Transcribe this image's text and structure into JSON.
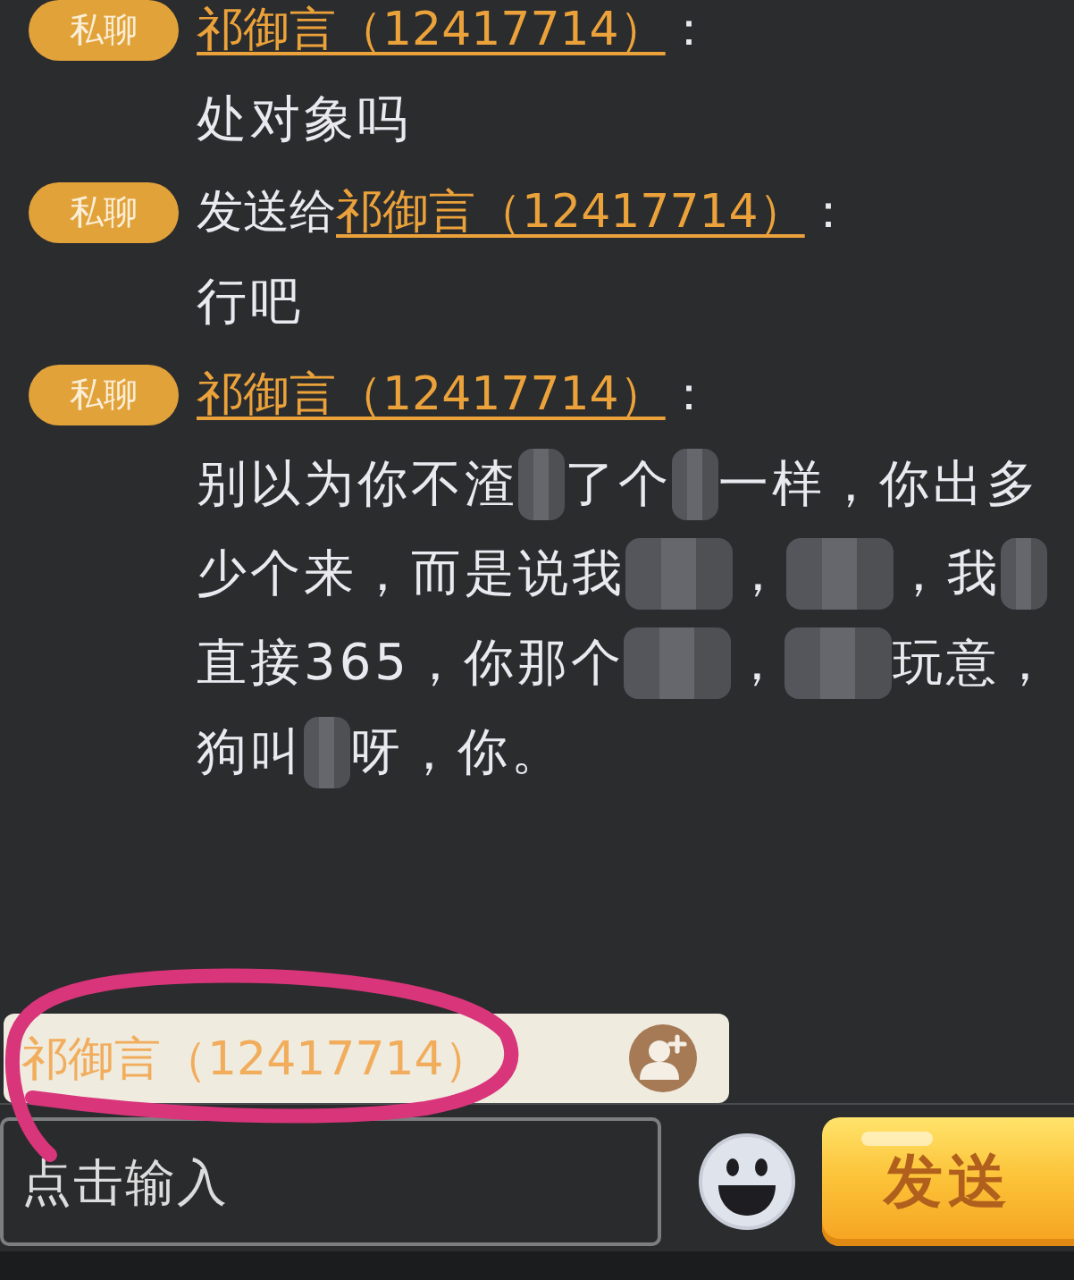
{
  "messages": [
    {
      "badge": "私聊",
      "name": "祁御言（12417714）",
      "separator": "：",
      "lines": [
        [
          {
            "kind": "text",
            "text": "处对象吗"
          }
        ]
      ]
    },
    {
      "badge": "私聊",
      "prefix": "发送给",
      "name": "祁御言（12417714）",
      "separator": "：",
      "lines": [
        [
          {
            "kind": "text",
            "text": "行吧"
          }
        ]
      ]
    },
    {
      "badge": "私聊",
      "name": "祁御言（12417714）",
      "separator": "：",
      "lines": [
        [
          {
            "kind": "text",
            "text": "别以为你不渣"
          },
          {
            "kind": "redacted",
            "wide": false
          },
          {
            "kind": "text",
            "text": "了个"
          },
          {
            "kind": "redacted",
            "wide": false
          },
          {
            "kind": "text",
            "text": "一样，你出多"
          }
        ],
        [
          {
            "kind": "text",
            "text": "少个来，而是说我"
          },
          {
            "kind": "redacted",
            "wide": true
          },
          {
            "kind": "text",
            "text": "，"
          },
          {
            "kind": "redacted",
            "wide": true
          },
          {
            "kind": "text",
            "text": "，我"
          },
          {
            "kind": "redacted",
            "wide": false
          }
        ],
        [
          {
            "kind": "text",
            "text": "直接365，你那个"
          },
          {
            "kind": "redacted",
            "wide": true
          },
          {
            "kind": "text",
            "text": "，"
          },
          {
            "kind": "redacted",
            "wide": true
          },
          {
            "kind": "text",
            "text": "玩意，"
          }
        ],
        [
          {
            "kind": "text",
            "text": "狗叫"
          },
          {
            "kind": "redacted",
            "wide": false
          },
          {
            "kind": "text",
            "text": "呀，你。"
          }
        ]
      ]
    }
  ],
  "reply_target": {
    "name": "祁御言（12417714）"
  },
  "composer": {
    "placeholder": "点击输入",
    "send": "发送"
  },
  "annotations": [
    {
      "kind": "loop"
    }
  ]
}
